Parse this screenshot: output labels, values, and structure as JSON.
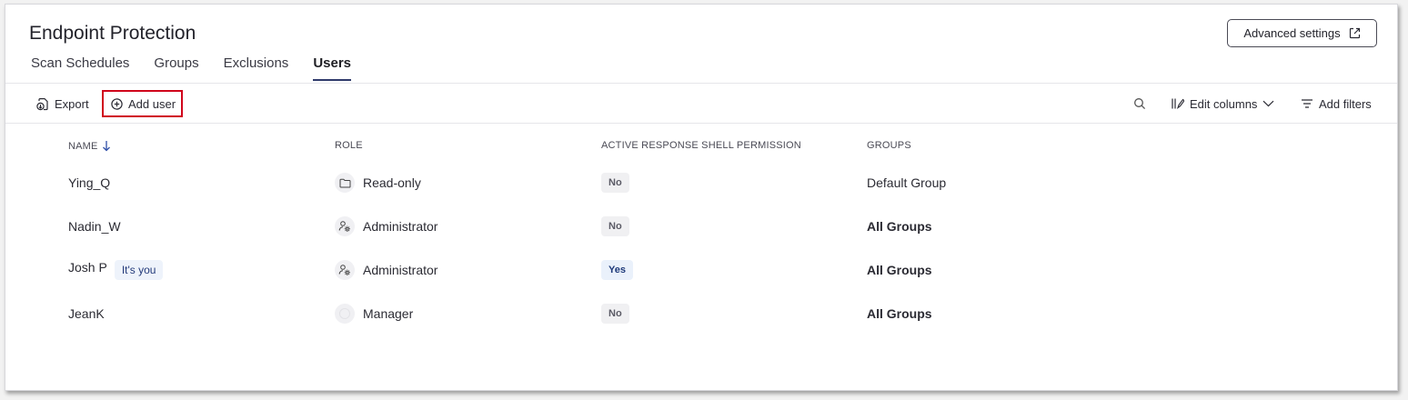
{
  "header": {
    "title": "Endpoint Protection",
    "advanced_settings_label": "Advanced settings"
  },
  "tabs": [
    {
      "label": "Scan Schedules",
      "active": false
    },
    {
      "label": "Groups",
      "active": false
    },
    {
      "label": "Exclusions",
      "active": false
    },
    {
      "label": "Users",
      "active": true
    }
  ],
  "toolbar": {
    "export_label": "Export",
    "add_user_label": "Add user",
    "edit_columns_label": "Edit columns",
    "add_filters_label": "Add filters"
  },
  "table": {
    "columns": {
      "name": "NAME",
      "role": "ROLE",
      "shell": "ACTIVE RESPONSE SHELL PERMISSION",
      "groups": "GROUPS"
    },
    "sort": {
      "column": "name",
      "direction": "descending-arrow"
    },
    "rows": [
      {
        "name": "Ying_Q",
        "badge": "",
        "role": "Read-only",
        "role_icon": "folder-icon",
        "shell": "No",
        "groups": "Default Group",
        "groups_bold": false
      },
      {
        "name": "Nadin_W",
        "badge": "",
        "role": "Administrator",
        "role_icon": "admin-gear-icon",
        "shell": "No",
        "groups": "All Groups",
        "groups_bold": true
      },
      {
        "name": "Josh P",
        "badge": "It's you",
        "role": "Administrator",
        "role_icon": "admin-gear-icon",
        "shell": "Yes",
        "groups": "All Groups",
        "groups_bold": true
      },
      {
        "name": "JeanK",
        "badge": "",
        "role": "Manager",
        "role_icon": "manager-icon",
        "shell": "No",
        "groups": "All Groups",
        "groups_bold": true
      }
    ]
  },
  "colors": {
    "accent": "#2f3a6b",
    "highlight_border": "#d0021b",
    "yes_badge_bg": "#eaf1fb"
  }
}
